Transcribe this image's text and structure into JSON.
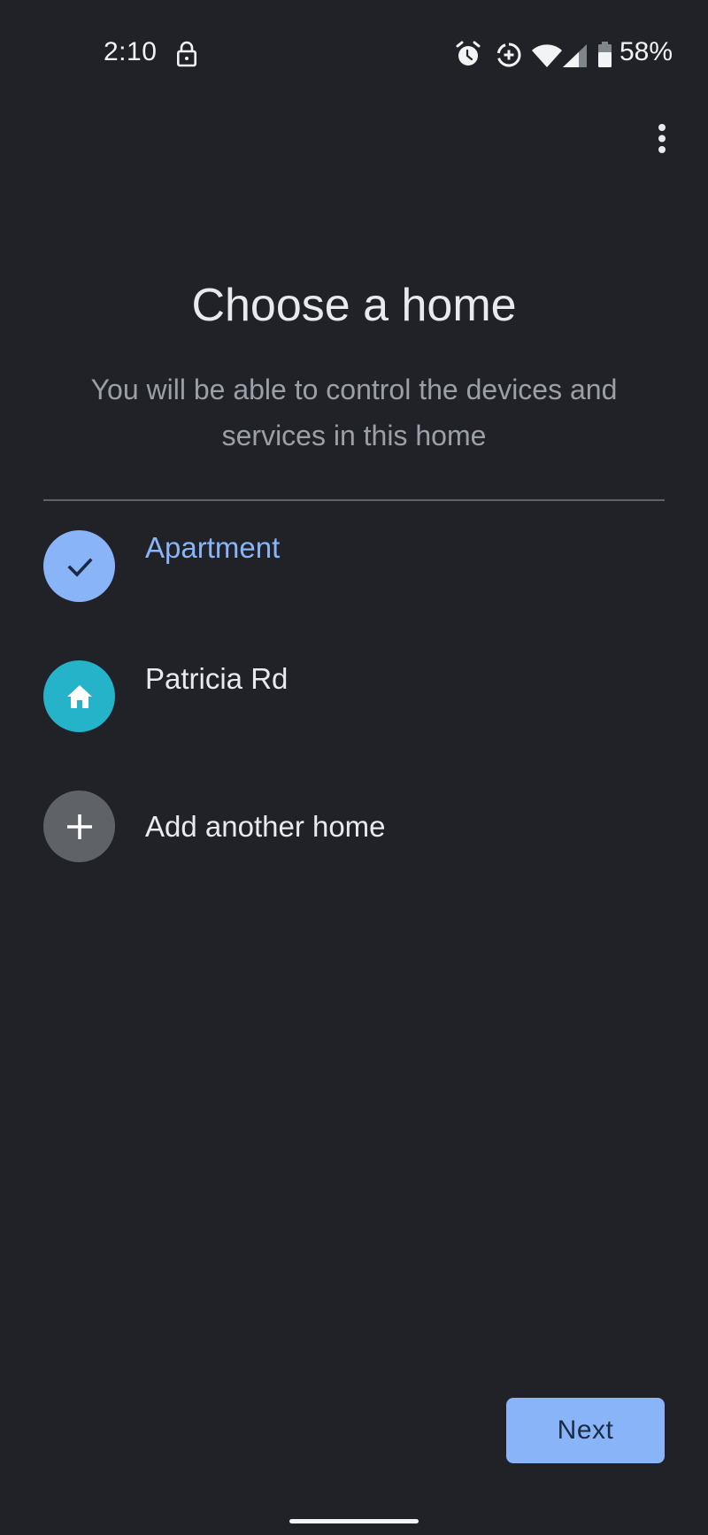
{
  "status_bar": {
    "time": "2:10",
    "battery_percent": "58%",
    "icons": [
      "lock-icon",
      "alarm-icon",
      "data-saver-icon",
      "wifi-icon",
      "cell-signal-icon",
      "battery-icon"
    ]
  },
  "header": {
    "menu_icon": "more-vert-icon"
  },
  "page": {
    "title": "Choose a home",
    "subtitle": "You will be able to control the devices and services in this home"
  },
  "homes": [
    {
      "label": "Apartment",
      "icon": "check-icon",
      "selected": true,
      "accent": "#8ab4f8"
    },
    {
      "label": "Patricia Rd",
      "icon": "home-icon",
      "selected": false,
      "accent": "#24b3c9"
    },
    {
      "label": "Add another home",
      "icon": "plus-icon",
      "selected": false,
      "accent": "#5f6368"
    }
  ],
  "footer": {
    "next_label": "Next"
  },
  "colors": {
    "background": "#212227",
    "primary": "#8ab4f8",
    "home_teal": "#24b3c9",
    "muted_text": "#9aa0a6"
  }
}
